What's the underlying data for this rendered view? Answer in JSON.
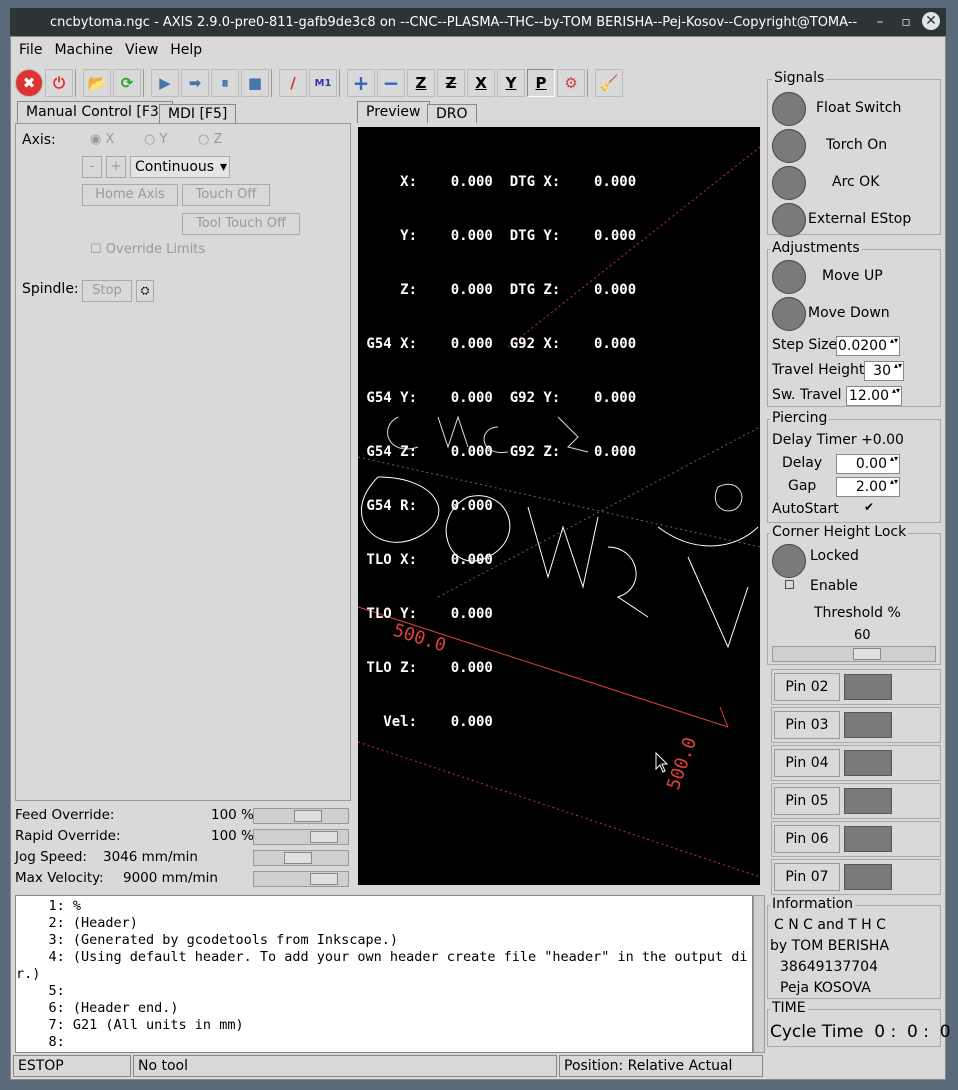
{
  "window": {
    "title": "cncbytoma.ngc - AXIS 2.9.0-pre0-811-gafb9de3c8 on --CNC--PLASMA--THC--by-TOM BERISHA--Pej-Kosov--Copyright@TOMA--"
  },
  "menu": [
    "File",
    "Machine",
    "View",
    "Help"
  ],
  "toolbar_icons": [
    "estop-icon",
    "power-icon",
    "open-icon",
    "reload-icon",
    "run-icon",
    "step-icon",
    "pause-icon",
    "stop-icon",
    "block-delete-icon",
    "optional-stop-icon",
    "zoom-in-icon",
    "zoom-out-icon",
    "view-z-icon",
    "view-z2-icon",
    "view-x-icon",
    "view-y-icon",
    "view-p-icon",
    "rotate-icon",
    "clear-plot-icon"
  ],
  "toolbar_glyphs": [
    "✖",
    "⏻",
    "📂",
    "⟳",
    "▶",
    "➡",
    "⏸",
    "■",
    "/",
    "M1",
    "+",
    "−",
    "Z",
    "Z",
    "X",
    "Y",
    "P",
    "⚙",
    "🧹"
  ],
  "left_tabs": {
    "manual": "Manual Control [F3]",
    "mdi": "MDI [F5]"
  },
  "manual": {
    "axis_label": "Axis:",
    "axes": [
      "X",
      "Y",
      "Z"
    ],
    "minus": "-",
    "plus": "+",
    "jog_mode": "Continuous",
    "home_axis": "Home Axis",
    "touch_off": "Touch Off",
    "tool_touch_off": "Tool Touch Off",
    "override_limits": "Override Limits",
    "spindle_label": "Spindle:",
    "spindle_stop": "Stop"
  },
  "overrides": {
    "feed_label": "Feed Override:",
    "feed_value": "100 %",
    "feed_level": 0.6,
    "rapid_label": "Rapid Override:",
    "rapid_value": "100 %",
    "rapid_level": 0.85,
    "jog_label": "Jog Speed:",
    "jog_value": "3046 mm/min",
    "jog_level": 0.45,
    "maxvel_label": "Max Velocity:",
    "maxvel_value": "9000 mm/min",
    "maxvel_level": 0.85
  },
  "right_tabs": {
    "preview": "Preview",
    "dro": "DRO"
  },
  "dro_lines": [
    "     X:    0.000  DTG X:    0.000",
    "     Y:    0.000  DTG Y:    0.000",
    "     Z:    0.000  DTG Z:    0.000",
    " G54 X:    0.000  G92 X:    0.000",
    " G54 Y:    0.000  G92 Y:    0.000",
    " G54 Z:    0.000  G92 Z:    0.000",
    " G54 R:    0.000",
    " TLO X:    0.000",
    " TLO Y:    0.000",
    " TLO Z:    0.000",
    "   Vel:    0.000"
  ],
  "preview": {
    "dim_x": "500.0",
    "dim_y": "500.0",
    "text_cnc": "CNC",
    "text_toma": "TOMA"
  },
  "gcode": [
    "    1: %",
    "    2: (Header)",
    "    3: (Generated by gcodetools from Inkscape.)",
    "    4: (Using default header. To add your own header create file \"header\" in the output di",
    "r.)",
    "    5:",
    "    6: (Header end.)",
    "    7: G21 (All units in mm)",
    "    8:"
  ],
  "status": {
    "state": "ESTOP",
    "tool": "No tool",
    "position": "Position: Relative Actual"
  },
  "signals": {
    "title": "Signals",
    "items": [
      "Float Switch",
      "Torch On",
      "Arc OK",
      "External EStop"
    ]
  },
  "adjustments": {
    "title": "Adjustments",
    "move_up": "Move UP",
    "move_down": "Move Down",
    "step_size_label": "Step Size",
    "step_size": "0.0200",
    "travel_height_label": "Travel Height",
    "travel_height": "30",
    "sw_travel_label": "Sw. Travel",
    "sw_travel": "12.00"
  },
  "piercing": {
    "title": "Piercing",
    "delay_timer": "Delay Timer +0.00",
    "delay_label": "Delay",
    "delay": "0.00",
    "gap_label": "Gap",
    "gap": "2.00",
    "autostart": "AutoStart",
    "autostart_mark": "✔"
  },
  "chl": {
    "title": "Corner Height Lock",
    "locked": "Locked",
    "enable": "Enable",
    "threshold_label": "Threshold %",
    "threshold": "60",
    "threshold_level": 0.6
  },
  "pins": [
    "Pin 02",
    "Pin 03",
    "Pin 04",
    "Pin 05",
    "Pin 06",
    "Pin 07"
  ],
  "information": {
    "title": "Information",
    "lines": [
      "C N C and T H C",
      "by TOM BERISHA",
      "38649137704",
      "Peja KOSOVA"
    ]
  },
  "time": {
    "title": "TIME",
    "cycle": "Cycle Time  0 :  0 :  0"
  },
  "colors": {
    "canvas": "#000000",
    "led": "#7a7a7a",
    "plot": "#ffffff",
    "limits": "#e04040"
  }
}
